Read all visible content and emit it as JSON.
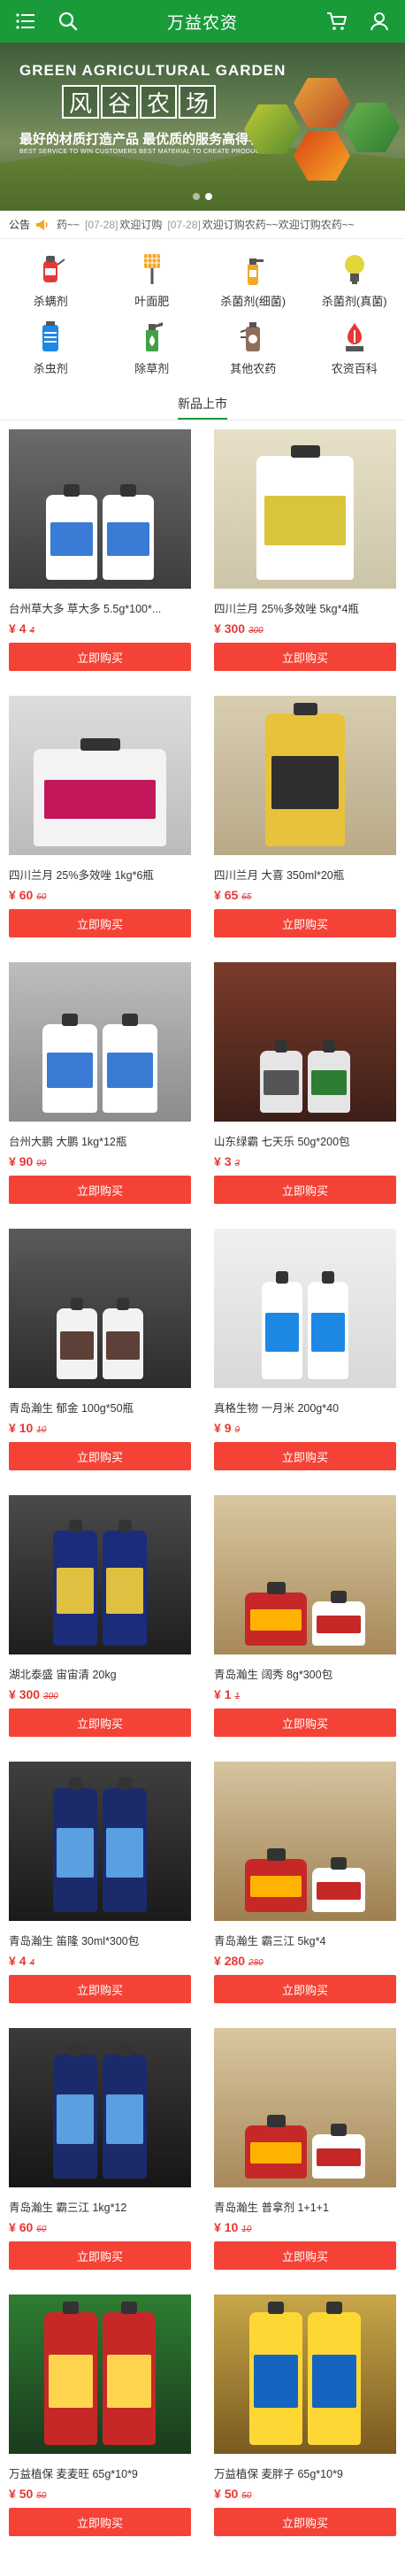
{
  "header": {
    "title": "万益农资"
  },
  "banner": {
    "en_title": "GREEN AGRICULTURAL GARDEN",
    "cn_title": [
      "风",
      "谷",
      "农",
      "场"
    ],
    "slogan": "最好的材质打造产品 最优质的服务高得客户",
    "sub": "BEST SERVICE TO WIN CUSTOMERS    BEST MATERIAL TO CREATE PRODUCTS"
  },
  "notice": {
    "tag": "公告",
    "items": [
      {
        "date": "",
        "text": "药~~"
      },
      {
        "date": "[07-28]",
        "text": "欢迎订购"
      },
      {
        "date": "[07-28]",
        "text": "欢迎订购农药~~欢迎订购农药~~"
      }
    ]
  },
  "categories": [
    {
      "label": "杀螨剂",
      "icon": "sprayer-icon",
      "color": "#e53935"
    },
    {
      "label": "叶面肥",
      "icon": "flyswatter-icon",
      "color": "#f5a623"
    },
    {
      "label": "杀菌剂(细菌)",
      "icon": "spray-bottle-icon",
      "color": "#f5a623"
    },
    {
      "label": "杀菌剂(真菌)",
      "icon": "bulb-icon",
      "color": "#e1d63a"
    },
    {
      "label": "杀虫剂",
      "icon": "insecticide-icon",
      "color": "#1e88e5"
    },
    {
      "label": "除草剂",
      "icon": "herbicide-icon",
      "color": "#43a047"
    },
    {
      "label": "其他农药",
      "icon": "pesticide-icon",
      "color": "#8e6e5a"
    },
    {
      "label": "农资百科",
      "icon": "encyclopedia-icon",
      "color": "#e53935"
    }
  ],
  "section_title": "新品上市",
  "buy_label": "立即购买",
  "currency": "¥",
  "products": [
    {
      "name": "台州草大多 草大多 5.5g*100*...",
      "price": "4",
      "old": "4"
    },
    {
      "name": "四川兰月 25%多效唑 5kg*4瓶",
      "price": "300",
      "old": "300"
    },
    {
      "name": "四川兰月 25%多效唑 1kg*6瓶",
      "price": "60",
      "old": "60"
    },
    {
      "name": "四川兰月 大喜 350ml*20瓶",
      "price": "65",
      "old": "65"
    },
    {
      "name": "台州大鹏 大鹏 1kg*12瓶",
      "price": "90",
      "old": "90"
    },
    {
      "name": "山东绿霸 七天乐 50g*200包",
      "price": "3",
      "old": "3"
    },
    {
      "name": "青岛瀚生 郁金 100g*50瓶",
      "price": "10",
      "old": "10"
    },
    {
      "name": "真格生物 一月米 200g*40",
      "price": "9",
      "old": "9"
    },
    {
      "name": "湖北泰盛 宙宙清 20kg",
      "price": "300",
      "old": "300"
    },
    {
      "name": "青岛瀚生 阔秀 8g*300包",
      "price": "1",
      "old": "1"
    },
    {
      "name": "青岛瀚生 笛隆 30ml*300包",
      "price": "4",
      "old": "4"
    },
    {
      "name": "青岛瀚生 霸三江 5kg*4",
      "price": "280",
      "old": "280"
    },
    {
      "name": "青岛瀚生 霸三江 1kg*12",
      "price": "60",
      "old": "60"
    },
    {
      "name": "青岛瀚生 普拿剂 1+1+1",
      "price": "10",
      "old": "10"
    },
    {
      "name": "万益植保 麦麦旺 65g*10*9",
      "price": "50",
      "old": "50"
    },
    {
      "name": "万益植保 麦胖子 65g*10*9",
      "price": "50",
      "old": "50"
    }
  ]
}
